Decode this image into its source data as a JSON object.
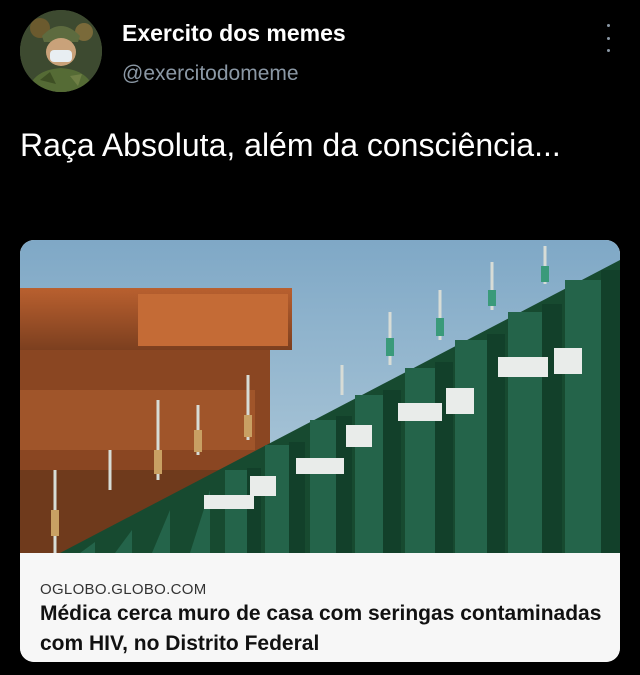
{
  "post": {
    "author_name": "Exercito dos memes",
    "author_handle": "@exercitodomeme",
    "avatar_icon": "soldier-avatar",
    "more_icon": "vertical-ellipsis-icon",
    "text": "Raça Absoluta, além da consciência..."
  },
  "card": {
    "domain": "OGLOBO.GLOBO.COM",
    "title": "Médica cerca muro de casa com seringas contaminadas com HIV, no Distrito Federal",
    "image_icon": "fence-with-syringes-photo"
  },
  "colors": {
    "background": "#000000",
    "name": "#ffffff",
    "handle": "#8b98a5",
    "card_meta_bg": "#f7f7f7",
    "sky": "#8fb4cc",
    "fence_green": "#1f5a3c"
  }
}
